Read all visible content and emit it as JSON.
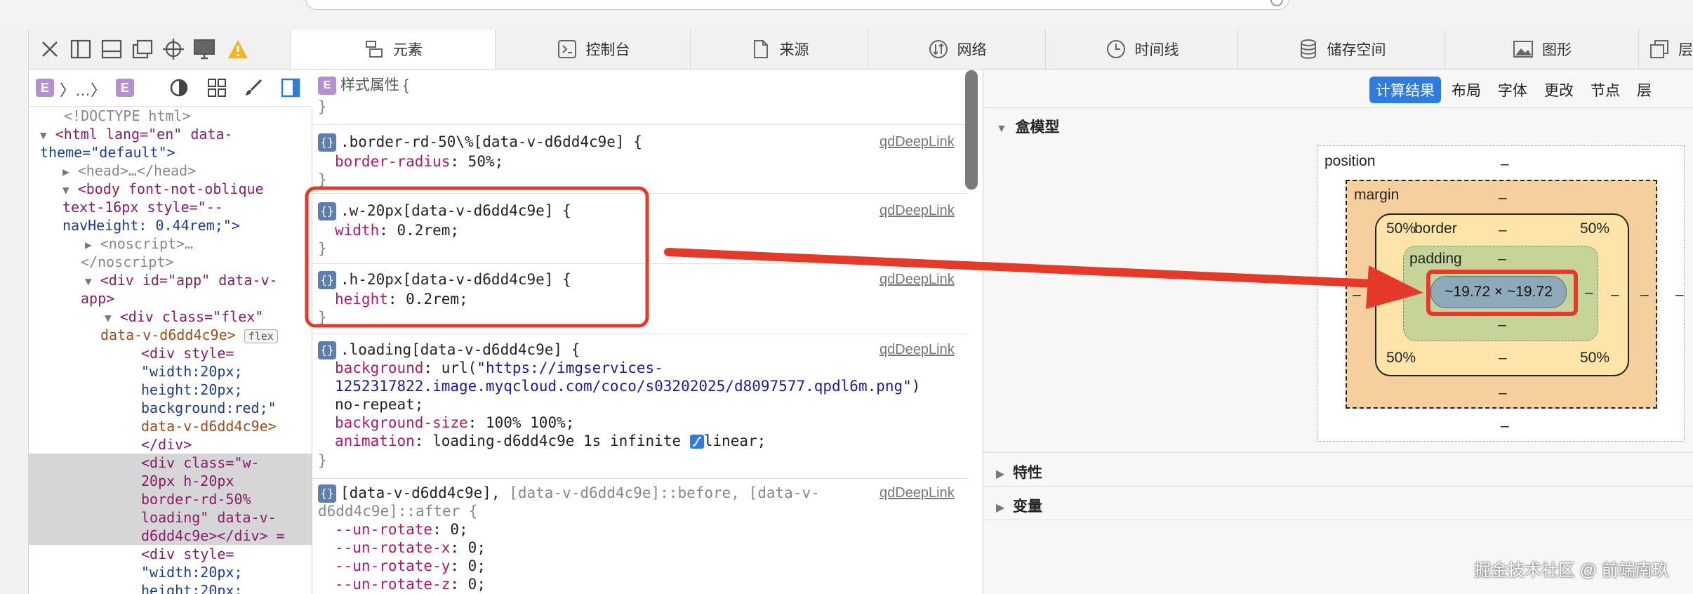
{
  "browser": {
    "address_bar": ""
  },
  "toolbar": {
    "icons": [
      "close-icon",
      "dock-left-icon",
      "dock-bottom-icon",
      "undock-icon",
      "inspect-crosshair-icon",
      "device-icon",
      "warning-icon"
    ]
  },
  "tabs": [
    {
      "label": "元素",
      "icon": "elements-icon",
      "active": true
    },
    {
      "label": "控制台",
      "icon": "console-icon"
    },
    {
      "label": "来源",
      "icon": "sources-icon"
    },
    {
      "label": "网络",
      "icon": "network-icon"
    },
    {
      "label": "时间线",
      "icon": "timeline-icon"
    },
    {
      "label": "储存空间",
      "icon": "storage-icon"
    },
    {
      "label": "图形",
      "icon": "graphics-icon"
    },
    {
      "label": "层",
      "icon": "layers-icon"
    }
  ],
  "dom_toolbar": {
    "crumb_e": "E",
    "crumb_sep": "〉…〉"
  },
  "dom": {
    "doctype": "<!DOCTYPE html>",
    "html_open": "<html lang=\"en\" data-",
    "html_open2": "theme=\"default\">",
    "head": "<head>…</head>",
    "body_open": "<body font-not-oblique",
    "body_open2": "text-16px style=\"--",
    "body_open3": "navHeight: 0.44rem;\">",
    "noscript_open": "<noscript>…",
    "noscript_close": "</noscript>",
    "div_app": "<div id=\"app\" data-v-",
    "div_app2": "app>",
    "div_flex": "<div class=\"flex\"",
    "div_flex2": "data-v-d6dd4c9e>",
    "flex_badge": "flex",
    "div_style1": "<div style=",
    "div_style2": "\"width:20px;",
    "div_style3": "height:20px;",
    "div_style4": "background:red;\"",
    "div_style5": "data-v-d6dd4c9e>",
    "div_style6": "</div>",
    "sel1": "<div class=\"w-",
    "sel2": "20px h-20px",
    "sel3": "border-rd-50%",
    "sel4": "loading\" data-v-",
    "sel5": "d6dd4c9e></div> =",
    "div2_1": "<div style=",
    "div2_2": "\"width:20px;",
    "div2_3": "height:20px;"
  },
  "styles": {
    "inline_selector": "样式属性 {",
    "inline_close": "}",
    "rules": [
      {
        "selector": ".border-rd-50\\%[data-v-d6dd4c9e] {",
        "prop": "border-radius",
        "value": "50%;",
        "source": "qdDeepLink"
      },
      {
        "selector": ".w-20px[data-v-d6dd4c9e] {",
        "prop": "width",
        "value": "0.2rem;",
        "source": "qdDeepLink"
      },
      {
        "selector": ".h-20px[data-v-d6dd4c9e] {",
        "prop": "height",
        "value": "0.2rem;",
        "source": "qdDeepLink"
      },
      {
        "selector": ".loading[data-v-d6dd4c9e] {",
        "source": "qdDeepLink",
        "bg_prop": "background",
        "bg_url_prefix": "url(\"",
        "bg_url1": "https://imgservices-",
        "bg_url2": "1252317822.image.myqcloud.com/coco/s03202025/d8097577.qpdl6m.png",
        "bg_url_suffix": "\")",
        "bg_repeat": "no-repeat;",
        "bgsize_prop": "background-size",
        "bgsize_val": "100% 100%;",
        "anim_prop": "animation",
        "anim_val": "loading-d6dd4c9e 1s infinite",
        "anim_ease": "linear;"
      },
      {
        "selector1": "[data-v-d6dd4c9e],",
        "selector2": " [data-v-d6dd4c9e]::before, [data-v-",
        "selector3": "d6dd4c9e]::after {",
        "source": "qdDeepLink",
        "props": [
          [
            "--un-rotate",
            "0;"
          ],
          [
            "--un-rotate-x",
            "0;"
          ],
          [
            "--un-rotate-y",
            "0;"
          ],
          [
            "--un-rotate-z",
            "0;"
          ]
        ]
      }
    ],
    "close_brace": "}"
  },
  "right_tabs": [
    "计算结果",
    "布局",
    "字体",
    "更改",
    "节点",
    "层"
  ],
  "box_model": {
    "section_title": "盒模型",
    "position_label": "position",
    "margin_label": "margin",
    "border_label": "border",
    "padding_label": "padding",
    "content_size": "~19.72 × ~19.72",
    "dash": "–",
    "radius": "50%"
  },
  "sections": {
    "traits": "特性",
    "variables": "变量"
  },
  "watermark": "掘金技术社区 @ 前端南玖",
  "colors": {
    "accent": "#2f7ce0",
    "annotation_red": "#e53a2a",
    "margin_fill": "#f6cf9e",
    "border_fill": "#fde4a8",
    "padding_fill": "#c6d49a",
    "content_fill": "#8ea9b9"
  }
}
